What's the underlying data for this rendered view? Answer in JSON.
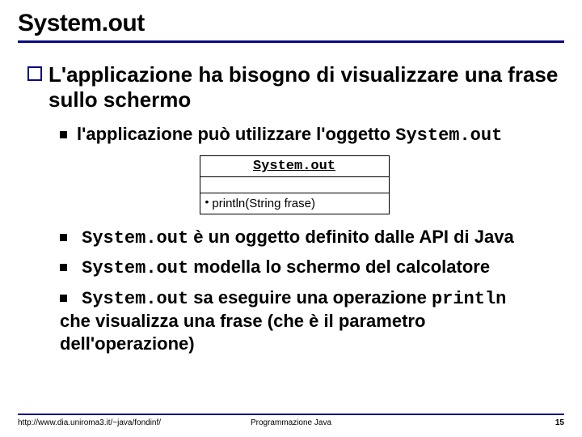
{
  "title": "System.out",
  "lvl1": "L'applicazione ha bisogno di visualizzare una frase sullo schermo",
  "lvl2a_prefix": "l'applicazione può utilizzare l'oggetto ",
  "lvl2a_code": "System.out",
  "uml": {
    "name": "System.out",
    "op": "println(String frase)"
  },
  "b1_code": "System.out",
  "b1_rest": " è un oggetto definito dalle API di Java",
  "b2_code": "System.out",
  "b2_rest": " modella lo schermo del calcolatore",
  "b3_code1": "System.out",
  "b3_mid": " sa eseguire una operazione ",
  "b3_code2": "println",
  "b3_rest": "che visualizza una frase (che è il parametro dell'operazione)",
  "footer": {
    "left": "http://www.dia.uniroma3.it/~java/fondinf/",
    "mid": "Programmazione Java",
    "right": "15"
  }
}
